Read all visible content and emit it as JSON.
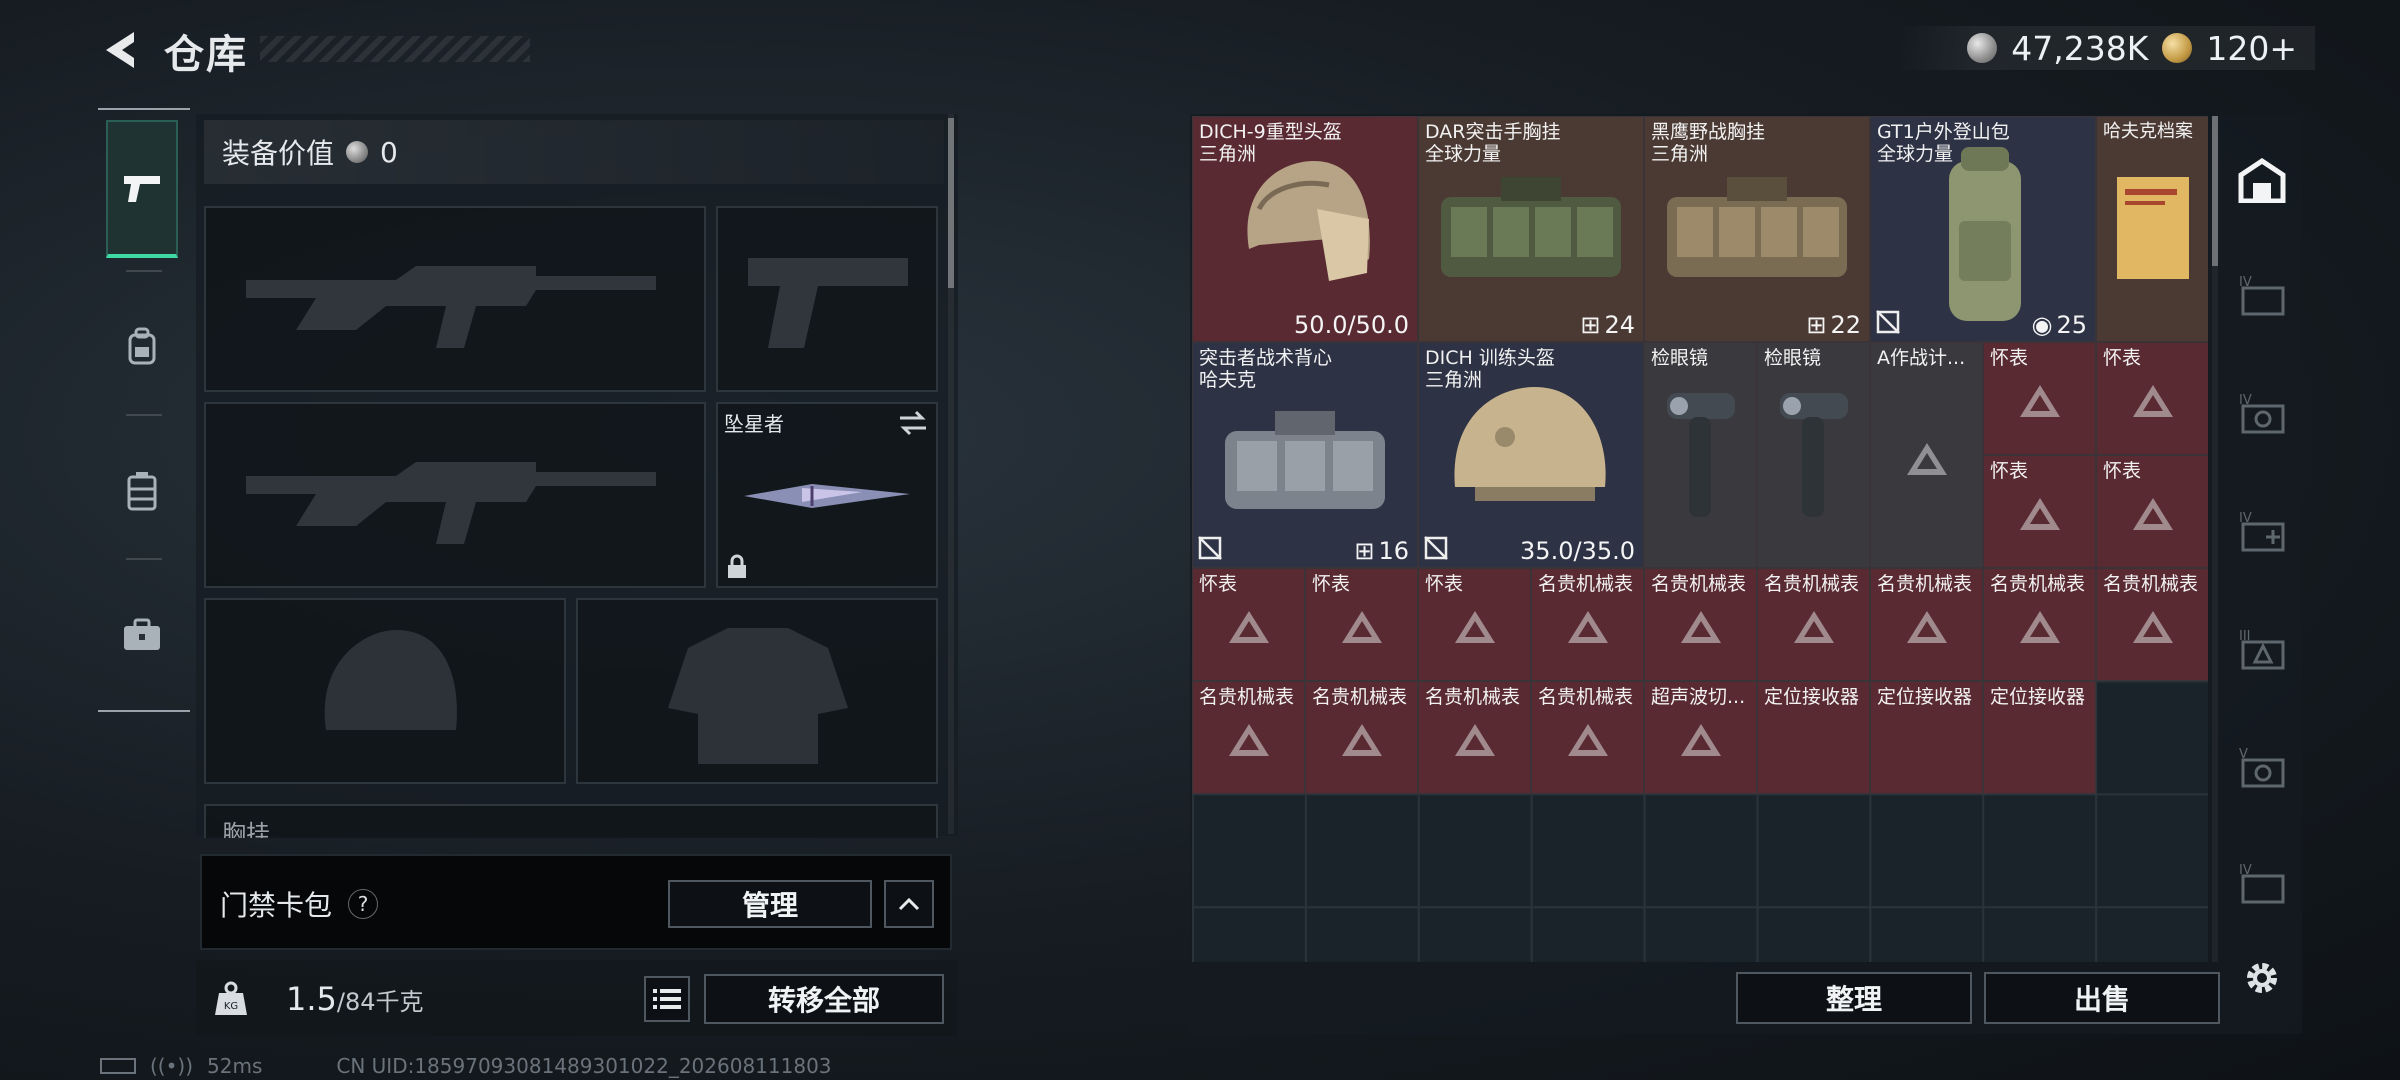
{
  "header": {
    "title": "仓库"
  },
  "currency": {
    "silver": "47,238K",
    "gold": "120+"
  },
  "left_tabs": [
    "weapon-tab",
    "backpack-tab",
    "vest-tab",
    "case-tab"
  ],
  "equipment": {
    "value_label": "装备价值",
    "value": "0",
    "melee_name": "坠星者",
    "partial_label": "胸挂"
  },
  "keycard": {
    "label": "门禁卡包",
    "help": "?",
    "manage_label": "管理"
  },
  "capacity": {
    "current": "1.5",
    "max_unit": "/84千克",
    "transfer_all_label": "转移全部"
  },
  "stash": {
    "items": [
      {
        "name": "DICH-9重型头盔",
        "sub": "三角洲",
        "count": "50.0/50.0"
      },
      {
        "name": "DAR突击手胸挂",
        "sub": "全球力量",
        "count": "24"
      },
      {
        "name": "黑鹰野战胸挂",
        "sub": "三角洲",
        "count": "22"
      },
      {
        "name": "GT1户外登山包",
        "sub": "全球力量",
        "count": "25"
      },
      {
        "name": "哈夫克档案",
        "sub": ""
      },
      {
        "name": "突击者战术背心",
        "sub": "哈夫克",
        "count": "16"
      },
      {
        "name": "DICH 训练头盔",
        "sub": "三角洲",
        "count": "35.0/35.0"
      },
      {
        "name": "检眼镜"
      },
      {
        "name": "检眼镜"
      },
      {
        "name": "A作战计..."
      },
      {
        "name": "怀表"
      },
      {
        "name": "怀表"
      },
      {
        "name": "怀表"
      },
      {
        "name": "怀表"
      },
      {
        "name": "怀表"
      },
      {
        "name": "怀表"
      },
      {
        "name": "怀表"
      },
      {
        "name": "名贵机械表"
      },
      {
        "name": "名贵机械表"
      },
      {
        "name": "名贵机械表"
      },
      {
        "name": "名贵机械表"
      },
      {
        "name": "名贵机械表"
      },
      {
        "name": "名贵机械表"
      },
      {
        "name": "名贵机械表"
      },
      {
        "name": "名贵机械表"
      },
      {
        "name": "名贵机械表"
      },
      {
        "name": "名贵机械表"
      },
      {
        "name": "超声波切..."
      },
      {
        "name": "定位接收器"
      },
      {
        "name": "定位接收器"
      },
      {
        "name": "定位接收器"
      }
    ],
    "sort_label": "整理",
    "sell_label": "出售"
  },
  "categories": [
    "all-items",
    "IV",
    "IV",
    "IV",
    "III",
    "V",
    "IV"
  ],
  "status": {
    "ping": "52ms",
    "uid": "CN UID:18597093081489301022_202608111803"
  },
  "colors": {
    "accent_green": "#3fd9a3",
    "rare_red": "#5a2a33"
  }
}
